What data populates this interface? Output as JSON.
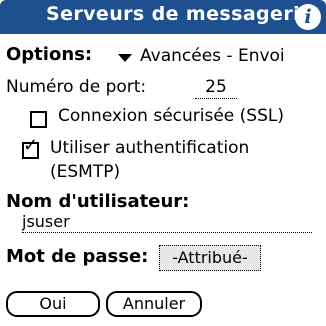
{
  "title_bar": {
    "title": "Serveurs de messagerie",
    "info_glyph": "i",
    "background": "#1e4f8e"
  },
  "options": {
    "label": "Options:",
    "selected": "Avancées - Envoi"
  },
  "port": {
    "label": "Numéro de port:",
    "value": "25"
  },
  "ssl": {
    "label": "Connexion sécurisée (SSL)",
    "checked": false
  },
  "auth": {
    "label_line1": "Utiliser authentification",
    "label_line2": "(ESMTP)",
    "checked": true,
    "check_glyph": "✓"
  },
  "username": {
    "label": "Nom d'utilisateur:",
    "value": "jsuser"
  },
  "password": {
    "label": "Mot de passe:",
    "value": "-Attribué-"
  },
  "buttons": {
    "ok": "Oui",
    "cancel": "Annuler"
  }
}
